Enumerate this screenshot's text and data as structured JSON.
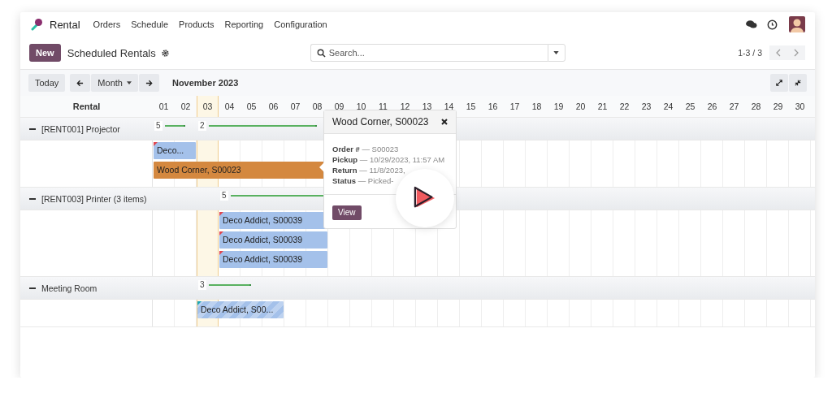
{
  "navbar": {
    "app": "Rental",
    "menu": [
      {
        "label": "Orders"
      },
      {
        "label": "Schedule"
      },
      {
        "label": "Products"
      },
      {
        "label": "Reporting"
      },
      {
        "label": "Configuration"
      }
    ]
  },
  "control_panel": {
    "new_button": "New",
    "title": "Scheduled Rentals",
    "search": {
      "placeholder": "Search..."
    },
    "pager": "1-3 / 3"
  },
  "toolbar": {
    "today_button": "Today",
    "scale": "Month",
    "period": "November 2023"
  },
  "gantt": {
    "row_header": "Rental",
    "days": [
      {
        "label": "01",
        "today": false
      },
      {
        "label": "02",
        "today": false
      },
      {
        "label": "03",
        "today": true
      },
      {
        "label": "04",
        "today": false
      },
      {
        "label": "05",
        "today": false
      },
      {
        "label": "06",
        "today": false
      },
      {
        "label": "07",
        "today": false
      },
      {
        "label": "08",
        "today": false
      },
      {
        "label": "09",
        "today": false
      },
      {
        "label": "10",
        "today": false
      },
      {
        "label": "11",
        "today": false
      },
      {
        "label": "12",
        "today": false
      },
      {
        "label": "13",
        "today": false
      },
      {
        "label": "14",
        "today": false
      },
      {
        "label": "15",
        "today": false
      },
      {
        "label": "16",
        "today": false
      },
      {
        "label": "17",
        "today": false
      },
      {
        "label": "18",
        "today": false
      },
      {
        "label": "19",
        "today": false
      },
      {
        "label": "20",
        "today": false
      },
      {
        "label": "21",
        "today": false
      },
      {
        "label": "22",
        "today": false
      },
      {
        "label": "23",
        "today": false
      },
      {
        "label": "24",
        "today": false
      },
      {
        "label": "25",
        "today": false
      },
      {
        "label": "26",
        "today": false
      },
      {
        "label": "27",
        "today": false
      },
      {
        "label": "28",
        "today": false
      },
      {
        "label": "29",
        "today": false
      },
      {
        "label": "30",
        "today": false
      }
    ],
    "groups": [
      {
        "label": "[RENT001] Projector",
        "expanded": true,
        "aggregates": [
          {
            "count": "5"
          },
          {
            "count": "2"
          }
        ],
        "pills": [
          {
            "text": "Deco...",
            "color": "#a4c1ea",
            "striped": false,
            "flag": {
              "color": "#e0464e"
            }
          },
          {
            "text": "Wood Corner, S00023",
            "color": "#d4883f",
            "striped": false
          }
        ]
      },
      {
        "label": "[RENT003] Printer (3 items)",
        "expanded": true,
        "aggregates": [
          {
            "count": "5"
          }
        ],
        "pills": [
          {
            "text": "Deco Addict, S00039",
            "color": "#a4c1ea",
            "striped": false,
            "flag": {
              "color": "#e0464e"
            }
          },
          {
            "text": "Deco Addict, S00039",
            "color": "#a4c1ea",
            "striped": false,
            "flag": {
              "color": "#e0464e"
            }
          },
          {
            "text": "Deco Addict, S00039",
            "color": "#a4c1ea",
            "striped": false,
            "flag": {
              "color": "#e0464e"
            }
          }
        ]
      },
      {
        "label": "Meeting Room",
        "expanded": true,
        "aggregates": [
          {
            "count": "3"
          }
        ],
        "pills": [
          {
            "text": "Deco Addict, S00...",
            "color": "#a4c1ea",
            "striped": true,
            "flag": {
              "color": "#1aa7b8"
            }
          }
        ]
      }
    ]
  },
  "popover": {
    "title": "Wood Corner, S00023",
    "lines": [
      "**Order #** — S00023",
      "**Pickup** — 10/29/2023, 11:57 AM",
      "**Return** — 11/8/2023,",
      "**Status** — Picked-"
    ],
    "button": "View"
  }
}
